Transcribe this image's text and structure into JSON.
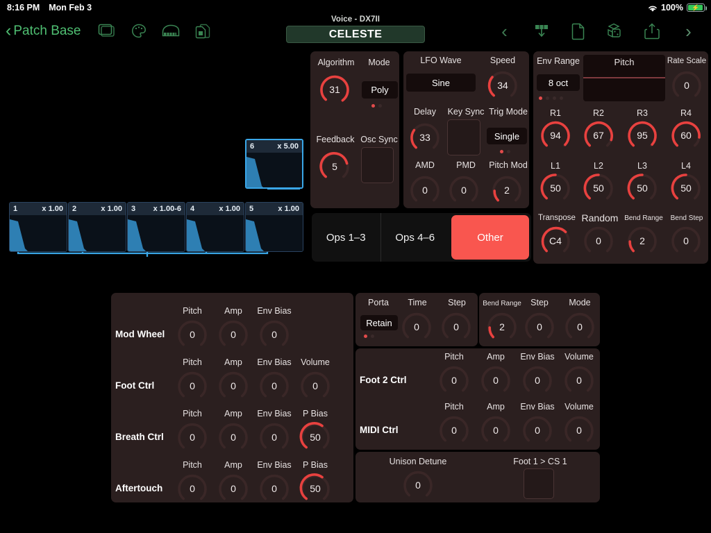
{
  "statusbar": {
    "time": "8:16 PM",
    "date": "Mon Feb 3",
    "battery_pct": "100%",
    "wifi_icon": "wifi-icon",
    "battery_icon": "battery-charging-icon"
  },
  "navbar": {
    "back_label": "Patch Base",
    "left_icons": [
      "window-icon",
      "palette-icon",
      "piano-icon",
      "documents-icon"
    ],
    "voice_label": "Voice - DX7II",
    "voice_name": "CELESTE",
    "right_icons": [
      "chevron-left-icon",
      "download-icon",
      "file-icon",
      "dice-icon",
      "share-icon",
      "chevron-right-icon"
    ]
  },
  "operators": [
    {
      "num": "1",
      "ratio": "x 1.00",
      "selected": false
    },
    {
      "num": "2",
      "ratio": "x 1.00",
      "selected": false
    },
    {
      "num": "3",
      "ratio": "x 1.00-6",
      "selected": false
    },
    {
      "num": "4",
      "ratio": "x 1.00",
      "selected": false
    },
    {
      "num": "5",
      "ratio": "x 1.00",
      "selected": false
    },
    {
      "num": "6",
      "ratio": "x 5.00",
      "selected": true
    }
  ],
  "algorithm_panel": {
    "algorithm_label": "Algorithm",
    "algorithm_value": "31",
    "mode_label": "Mode",
    "mode_value": "Poly",
    "mode_dots": [
      true,
      false
    ],
    "feedback_label": "Feedback",
    "feedback_value": "5",
    "osc_sync_label": "Osc Sync",
    "osc_sync_value": ""
  },
  "lfo_panel": {
    "wave_label": "LFO Wave",
    "wave_value": "Sine",
    "speed_label": "Speed",
    "speed_value": "34",
    "delay_label": "Delay",
    "delay_value": "33",
    "key_sync_label": "Key Sync",
    "key_sync_value": "",
    "trig_mode_label": "Trig Mode",
    "trig_mode_value": "Single",
    "trig_dots": [
      true,
      false
    ],
    "amd_label": "AMD",
    "amd_value": "0",
    "pmd_label": "PMD",
    "pmd_value": "0",
    "pitch_mod_label": "Pitch Mod",
    "pitch_mod_value": "2"
  },
  "pitch_panel": {
    "env_range_label": "Env Range",
    "env_range_value": "8 oct",
    "env_range_dots": [
      true,
      false,
      false,
      false
    ],
    "pitch_title": "Pitch",
    "rate_scale_label": "Rate Scale",
    "rate_scale_value": "0",
    "rates": [
      {
        "label": "R1",
        "value": "94"
      },
      {
        "label": "R2",
        "value": "67"
      },
      {
        "label": "R3",
        "value": "95"
      },
      {
        "label": "R4",
        "value": "60"
      }
    ],
    "levels": [
      {
        "label": "L1",
        "value": "50"
      },
      {
        "label": "L2",
        "value": "50"
      },
      {
        "label": "L3",
        "value": "50"
      },
      {
        "label": "L4",
        "value": "50"
      }
    ],
    "extras": [
      {
        "label": "Transpose",
        "value": "C4"
      },
      {
        "label": "Random",
        "value": "0"
      },
      {
        "label": "Bend Range",
        "value": "2"
      },
      {
        "label": "Bend Step",
        "value": "0"
      }
    ]
  },
  "op_tabs": [
    {
      "label": "Ops 1–3",
      "active": false
    },
    {
      "label": "Ops 4–6",
      "active": false
    },
    {
      "label": "Other",
      "active": true
    }
  ],
  "controllers_left": {
    "rows": [
      {
        "name": "Mod Wheel",
        "params": [
          {
            "label": "Pitch",
            "value": "0"
          },
          {
            "label": "Amp",
            "value": "0"
          },
          {
            "label": "Env Bias",
            "value": "0"
          }
        ]
      },
      {
        "name": "Foot Ctrl",
        "params": [
          {
            "label": "Pitch",
            "value": "0"
          },
          {
            "label": "Amp",
            "value": "0"
          },
          {
            "label": "Env Bias",
            "value": "0"
          },
          {
            "label": "Volume",
            "value": "0"
          }
        ]
      },
      {
        "name": "Breath Ctrl",
        "params": [
          {
            "label": "Pitch",
            "value": "0"
          },
          {
            "label": "Amp",
            "value": "0"
          },
          {
            "label": "Env Bias",
            "value": "0"
          },
          {
            "label": "P Bias",
            "value": "50"
          }
        ]
      },
      {
        "name": "Aftertouch",
        "params": [
          {
            "label": "Pitch",
            "value": "0"
          },
          {
            "label": "Amp",
            "value": "0"
          },
          {
            "label": "Env Bias",
            "value": "0"
          },
          {
            "label": "P Bias",
            "value": "50"
          }
        ]
      }
    ]
  },
  "porta_panel": {
    "porta_label": "Porta",
    "porta_value": "Retain",
    "porta_dots": [
      true,
      false
    ],
    "time_label": "Time",
    "time_value": "0",
    "step_label": "Step",
    "step_value": "0"
  },
  "bend_panel": {
    "bend_range_label": "Bend Range",
    "bend_range_value": "2",
    "step_label": "Step",
    "step_value": "0",
    "mode_label": "Mode",
    "mode_value": "0"
  },
  "controllers_right": {
    "rows": [
      {
        "name": "Foot 2 Ctrl",
        "params": [
          {
            "label": "Pitch",
            "value": "0"
          },
          {
            "label": "Amp",
            "value": "0"
          },
          {
            "label": "Env Bias",
            "value": "0"
          },
          {
            "label": "Volume",
            "value": "0"
          }
        ]
      },
      {
        "name": "MIDI Ctrl",
        "params": [
          {
            "label": "Pitch",
            "value": "0"
          },
          {
            "label": "Amp",
            "value": "0"
          },
          {
            "label": "Env Bias",
            "value": "0"
          },
          {
            "label": "Volume",
            "value": "0"
          }
        ]
      }
    ]
  },
  "misc_panel": {
    "unison_label": "Unison Detune",
    "unison_value": "0",
    "foot_cs_label": "Foot 1 > CS 1",
    "foot_cs_value": ""
  },
  "colors": {
    "accent_red": "#f9564f",
    "knob_arc": "#e8413f",
    "knob_track": "#3a2727",
    "panel_bg": "#2b1f1f",
    "op_blue": "#3aa7e8",
    "nav_green": "#4fbf72"
  }
}
